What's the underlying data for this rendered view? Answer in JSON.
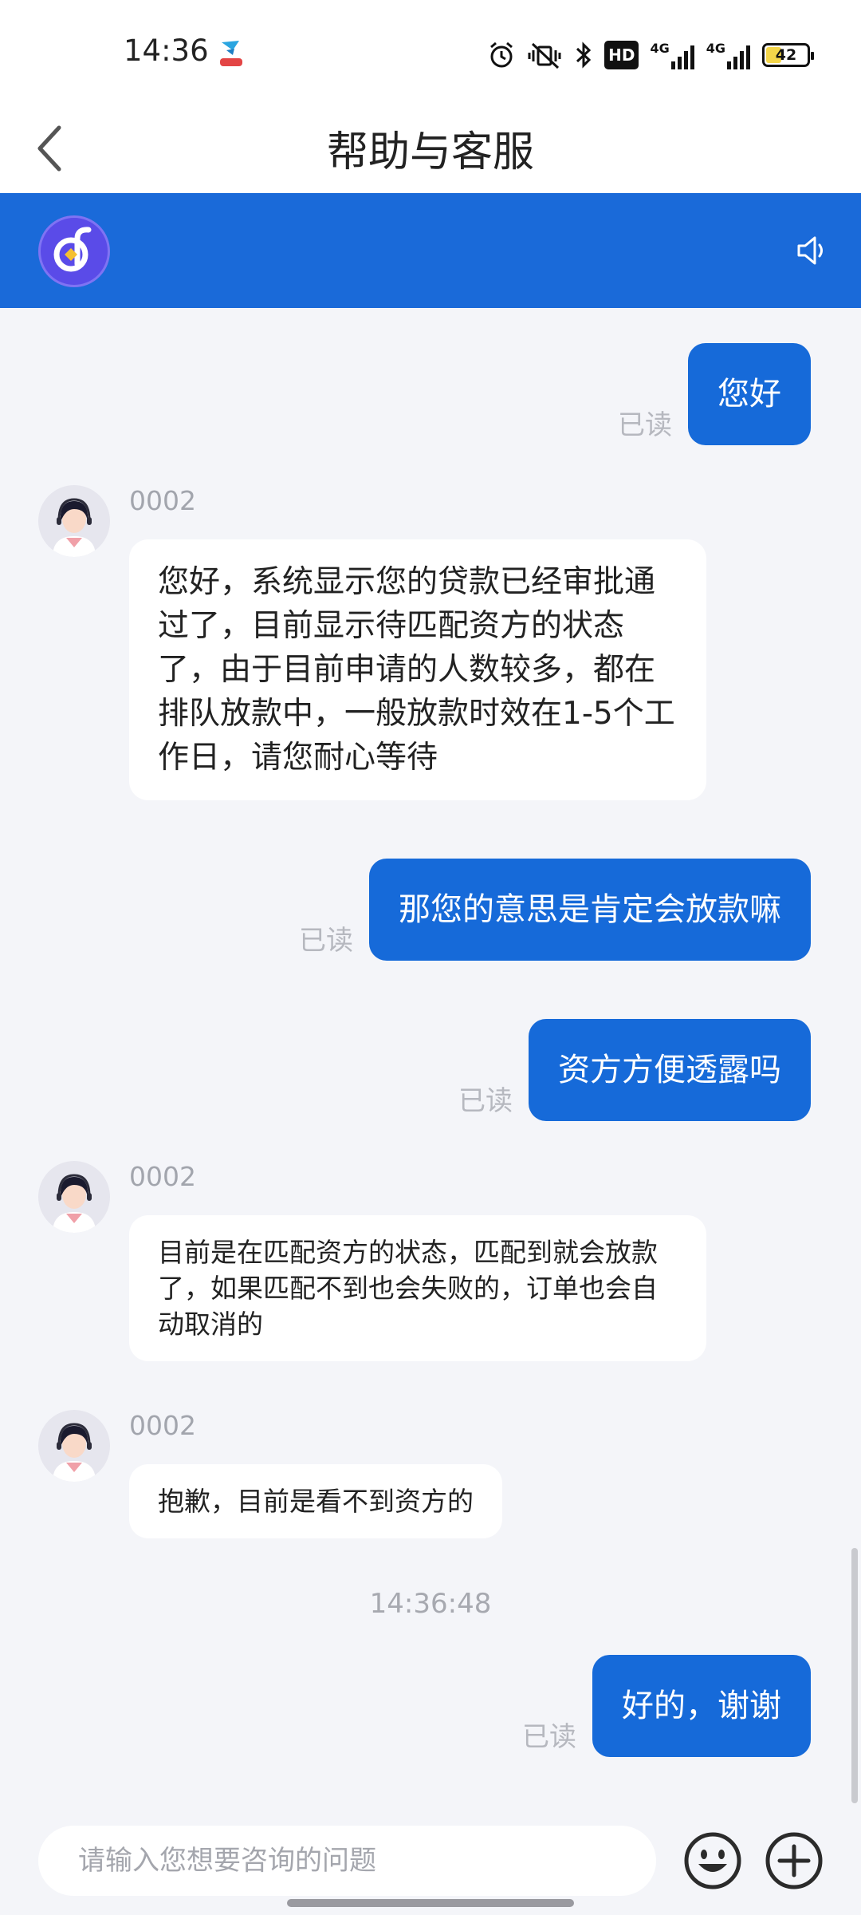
{
  "status_bar": {
    "time": "14:36",
    "network_hd": "HD",
    "network_1": "4G",
    "network_2": "4G",
    "battery_level": "42",
    "battery_fraction": 0.42
  },
  "header": {
    "title": "帮助与客服"
  },
  "colors": {
    "brand_blue": "#166ad9",
    "banner_blue": "#1a6ad9",
    "logo_purple": "#5a4be8"
  },
  "icons": {
    "back": "chevron-left-icon",
    "speaker": "speaker-icon",
    "emoji": "smiley-icon",
    "plus": "plus-circle-icon"
  },
  "messages": [
    {
      "side": "right",
      "text": "您好",
      "status": "已读"
    },
    {
      "side": "left",
      "sender": "0002",
      "text": "您好，系统显示您的贷款已经审批通过了，目前显示待匹配资方的状态了，由于目前申请的人数较多，都在排队放款中，一般放款时效在1-5个工作日，请您耐心等待"
    },
    {
      "side": "right",
      "text": "那您的意思是肯定会放款嘛",
      "status": "已读"
    },
    {
      "side": "right",
      "text": "资方方便透露吗",
      "status": "已读"
    },
    {
      "side": "left",
      "sender": "0002",
      "text": "目前是在匹配资方的状态，匹配到就会放款了，如果匹配不到也会失败的，订单也会自动取消的"
    },
    {
      "side": "left",
      "sender": "0002",
      "text": "抱歉，目前是看不到资方的"
    },
    {
      "side": "right",
      "text": "好的，谢谢",
      "status": "已读"
    }
  ],
  "timestamp": "14:36:48",
  "input": {
    "placeholder": "请输入您想要咨询的问题",
    "value": ""
  }
}
